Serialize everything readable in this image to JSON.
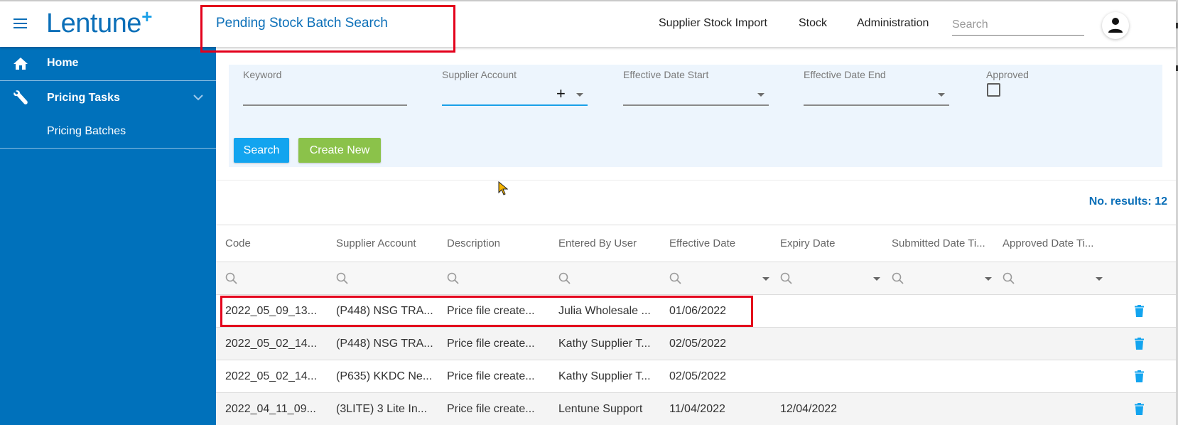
{
  "header": {
    "logo_text": "Lentune",
    "logo_plus": "+",
    "page_title": "Pending Stock Batch Search",
    "nav": [
      {
        "label": "Supplier Stock Import"
      },
      {
        "label": "Stock"
      },
      {
        "label": "Administration"
      }
    ],
    "search_placeholder": "Search",
    "search_value": ""
  },
  "sidebar": {
    "items": [
      {
        "label": "Home",
        "icon": "home-icon"
      },
      {
        "label": "Pricing Tasks",
        "icon": "wrench-icon",
        "expanded": true
      },
      {
        "label": "Pricing Batches"
      }
    ]
  },
  "filters": {
    "keyword": {
      "label": "Keyword",
      "value": ""
    },
    "supplier_account": {
      "label": "Supplier Account",
      "value": ""
    },
    "effective_date_start": {
      "label": "Effective Date Start",
      "value": ""
    },
    "effective_date_end": {
      "label": "Effective Date End",
      "value": ""
    },
    "approved": {
      "label": "Approved",
      "checked": false
    },
    "search_button": "Search",
    "create_button": "Create New"
  },
  "results": {
    "label": "No. results: 12",
    "count": 12
  },
  "table": {
    "columns": [
      "Code",
      "Supplier Account",
      "Description",
      "Entered By User",
      "Effective Date",
      "Expiry Date",
      "Submitted Date Ti...",
      "Approved Date Ti..."
    ],
    "rows": [
      {
        "code": "2022_05_09_13...",
        "supplier": "(P448) NSG TRA...",
        "description": "Price file create...",
        "user": "Julia Wholesale ...",
        "effective": "01/06/2022",
        "expiry": "",
        "submitted": "",
        "approved": ""
      },
      {
        "code": "2022_05_02_14...",
        "supplier": "(P448) NSG TRA...",
        "description": "Price file create...",
        "user": "Kathy Supplier T...",
        "effective": "02/05/2022",
        "expiry": "",
        "submitted": "",
        "approved": ""
      },
      {
        "code": "2022_05_02_14...",
        "supplier": "(P635) KKDC Ne...",
        "description": "Price file create...",
        "user": "Kathy Supplier T...",
        "effective": "02/05/2022",
        "expiry": "",
        "submitted": "",
        "approved": ""
      },
      {
        "code": "2022_04_11_09...",
        "supplier": "(3LITE) 3 Lite In...",
        "description": "Price file create...",
        "user": "Lentune Support",
        "effective": "11/04/2022",
        "expiry": "12/04/2022",
        "submitted": "",
        "approved": ""
      }
    ]
  },
  "colors": {
    "brand": "#0b6fb8",
    "sidebar": "#0071bb",
    "search_button": "#12a4ef",
    "create_button": "#8bc24a",
    "delete_icon": "#12a4ef",
    "highlight": "#e3001b"
  }
}
